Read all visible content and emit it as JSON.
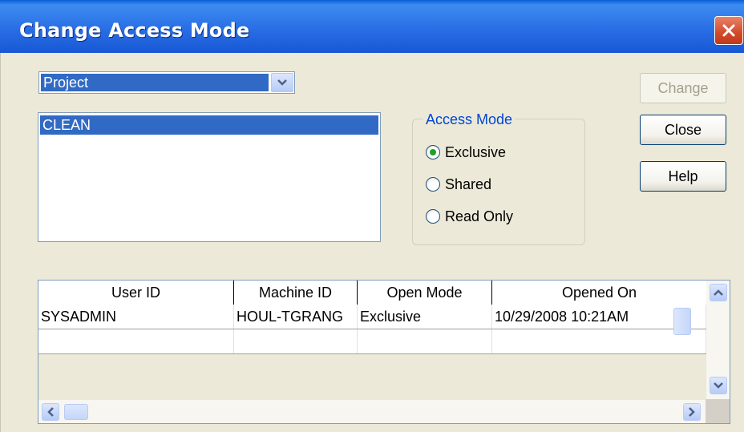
{
  "window": {
    "title": "Change Access Mode",
    "close_icon": "close-x-icon"
  },
  "type_select": {
    "value": "Project"
  },
  "list": {
    "items": [
      "CLEAN"
    ]
  },
  "access_mode": {
    "legend": "Access Mode",
    "options": [
      {
        "label": "Exclusive",
        "checked": true
      },
      {
        "label": "Shared",
        "checked": false
      },
      {
        "label": "Read Only",
        "checked": false
      }
    ]
  },
  "buttons": {
    "change": "Change",
    "close": "Close",
    "help": "Help"
  },
  "grid": {
    "columns": [
      "User ID",
      "Machine ID",
      "Open Mode",
      "Opened On"
    ],
    "rows": [
      [
        "SYSADMIN",
        "HOUL-TGRANG",
        "Exclusive",
        "10/29/2008 10:21AM"
      ]
    ]
  },
  "colors": {
    "selection": "#316ac5",
    "titlebar": "#2a6fe6",
    "dialog_bg": "#ece9d8",
    "legend_text": "#0046d5"
  }
}
